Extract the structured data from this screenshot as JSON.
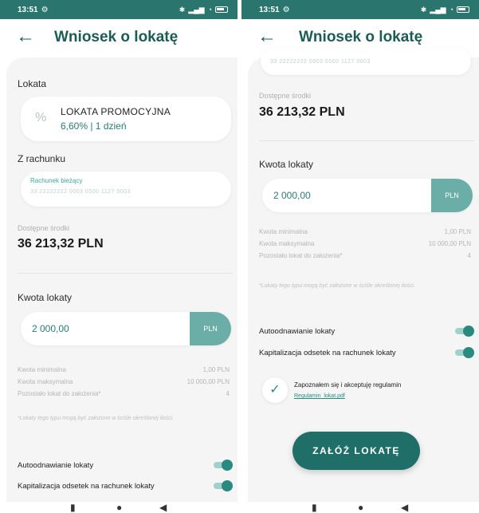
{
  "left": {
    "status_time": "13:51",
    "title": "Wniosek o lokatę",
    "lokata_section": "Lokata",
    "lokata_name": "LOKATA PROMOCYJNA",
    "lokata_rate": "6,60% | 1 dzień",
    "account_section": "Z rachunku",
    "account_label": "Rachunek bieżący",
    "account_number": "33 22222222 0003 0500 1127 0003",
    "avail_label": "Dostępne środki",
    "avail_value": "36 213,32 PLN",
    "amount_section": "Kwota lokaty",
    "amount_value": "2 000,00",
    "currency": "PLN",
    "limits": [
      {
        "label": "Kwota minimalna",
        "value": "1,00 PLN"
      },
      {
        "label": "Kwota maksymalna",
        "value": "10 000,00 PLN"
      },
      {
        "label": "Pozostało lokat do założenia*",
        "value": "4"
      }
    ],
    "footnote": "*Lokaty tego typu mogą być założone w ściśle określonej ilości.",
    "toggle_renew": "Autoodnawianie lokaty",
    "toggle_cap": "Kapitalizacja odsetek na rachunek lokaty"
  },
  "right": {
    "status_time": "13:51",
    "title": "Wniosek o lokatę",
    "account_number": "33 22222222 0003 0500 1127 0003",
    "avail_label": "Dostępne środki",
    "avail_value": "36 213,32 PLN",
    "amount_section": "Kwota lokaty",
    "amount_value": "2 000,00",
    "currency": "PLN",
    "limits": [
      {
        "label": "Kwota minimalna",
        "value": "1,00 PLN"
      },
      {
        "label": "Kwota maksymalna",
        "value": "10 000,00 PLN"
      },
      {
        "label": "Pozostało lokat do założenia*",
        "value": "4"
      }
    ],
    "footnote": "*Lokaty tego typu mogą być założone w ściśle określonej ilości.",
    "toggle_renew": "Autoodnawianie lokaty",
    "toggle_cap": "Kapitalizacja odsetek na rachunek lokaty",
    "terms_text": "Zapoznałem się i akceptuję regulamin",
    "terms_link": "Regulamin_lokat.pdf",
    "cta_label": "ZAŁÓŻ LOKATĘ"
  },
  "icons": {
    "back": "arrow-left-icon",
    "percent": "percent-icon",
    "check": "check-icon",
    "settings": "gear-icon",
    "battery": "battery-icon",
    "wifi": "wifi-icon",
    "signal": "signal-icon"
  },
  "colors": {
    "brand": "#1f6f68",
    "accent": "#2a8a80",
    "status_bar": "#2a766f"
  }
}
